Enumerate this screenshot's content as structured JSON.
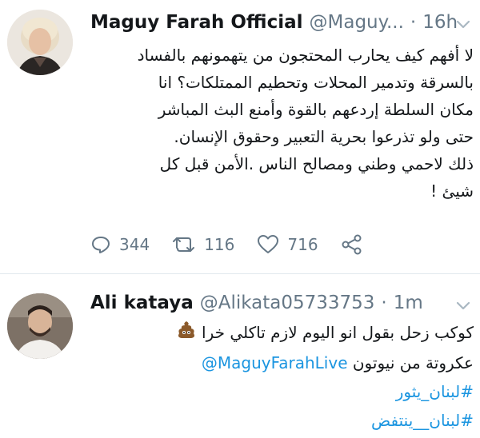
{
  "tweet_main": {
    "author_name": "Maguy Farah Official",
    "handle": "@Maguy...",
    "separator": "·",
    "time": "16h",
    "text_lines": [
      "لا أفهم كيف يحارب المحتجون من يتهمونهم بالفساد",
      "بالسرقة وتدمير المحلات وتحطيم الممتلكات؟ انا",
      "مكان السلطة إردعهم بالقوة وأمنع البث المباشر",
      "حتى ولو  تذرعوا بحرية التعبير وحقوق الإنسان.",
      "ذلك لاحمي وطني ومصالح الناس .الأمن قبل كل",
      "شيئ !"
    ],
    "replies": "344",
    "retweets": "116",
    "likes": "716"
  },
  "tweet_reply": {
    "author_name": "Ali kataya",
    "handle": "@Alikata05733753",
    "separator": "·",
    "time": "1m",
    "text_line1": "كوكب زحل بقول انو اليوم لازم تاكلي خرا",
    "text_line2_mention": "@MaguyFarahLive",
    "text_line2_rest": "عكروتة من نيوتون",
    "hashtag1": "#لبنان_يثور",
    "hashtag2": "#لبنان__ينتفض"
  },
  "colors": {
    "link": "#1b95e0",
    "muted": "#657786",
    "text": "#14171a",
    "divider": "#e1e8ed"
  }
}
